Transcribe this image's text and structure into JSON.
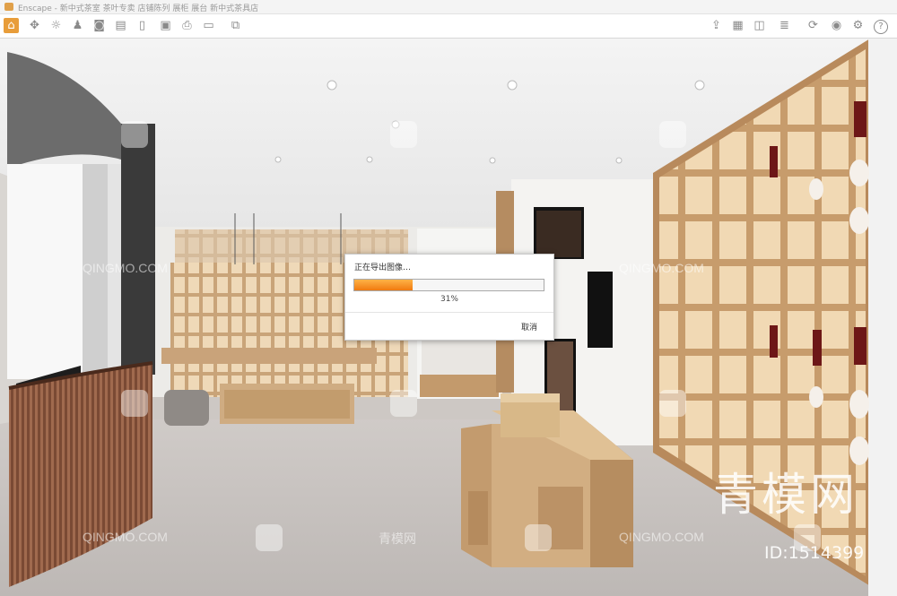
{
  "window": {
    "title": "Enscape - 新中式茶室 茶叶专卖 店铺陈列 展柜 展台 新中式茶具店"
  },
  "toolbar": {
    "icons": [
      "home-icon",
      "move-icon",
      "sun-icon",
      "people-icon",
      "camera-icon",
      "save-icon",
      "bookmark-icon",
      "settings-icon",
      "render-icon",
      "export-icon",
      "video-icon",
      "panorama-icon",
      "upload-icon",
      "grid-icon",
      "cube-icon",
      "eye-icon",
      "gear-icon",
      "help-icon"
    ]
  },
  "dialog": {
    "title": "正在导出图像…",
    "progress": 0.31,
    "percent_text": "31%",
    "cancel_label": "取消"
  },
  "watermarks": {
    "text": "QINGMO.COM",
    "cn_text": "青模网",
    "big_text": "青模网",
    "id_text": "ID:1514399"
  },
  "colors": {
    "accent": "#f07a10",
    "shelf_wood": "#d9b98e",
    "floor": "#cfcac6"
  }
}
